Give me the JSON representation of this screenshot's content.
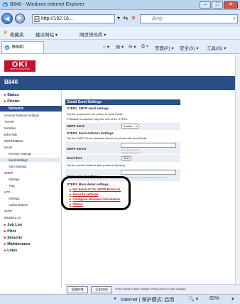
{
  "window": {
    "title": "B840 - Windows Internet Explorer",
    "minimize": "‒",
    "maximize": "□",
    "close": "✕"
  },
  "nav": {
    "back": "◀",
    "forward": "▶",
    "address": "http://192.16...",
    "address_dropdown": "▾",
    "refresh": "⟳",
    "compat": "⇆",
    "stop": "✕",
    "search_placeholder": "Bing",
    "search_icon": "⌕"
  },
  "favorites_bar": {
    "favorites": "收藏夹",
    "suggested": "建议网站 ▾",
    "gallery": "网页快讯库 ▾"
  },
  "tab": {
    "label": "B840"
  },
  "command_bar": {
    "home": "⌂ ▾",
    "feeds": "▤ ▾",
    "mail": "✉ ▾",
    "print": "⎙ ▾",
    "page": "页面(P) ▾",
    "safety": "安全(S) ▾",
    "tools": "工具(O) ▾"
  },
  "brand": {
    "logo": "OKI",
    "tagline": "PRINTING SOLUTIONS",
    "model": "B840"
  },
  "sidebar": {
    "status": "Status",
    "printer": "Printer",
    "network": "Network",
    "items": [
      "General Network Settings",
      "TCP/IP",
      "NetWare",
      "EtherTalk",
      "NBT/NetBEUI",
      "Email",
      "Receive Settings",
      "Send Settings",
      "Alert Settings",
      "SNMP",
      "Settings",
      "Trap",
      "LPP",
      "Settings",
      "Authentication",
      "SNTP",
      "IEEE802.1X"
    ],
    "job_list": "Job List",
    "print": "Print",
    "security": "Security",
    "maintenance": "Maintenance",
    "links": "Links"
  },
  "main": {
    "title": "Email Send Settings",
    "step1": "STEP1. SMTP send settings",
    "step1_desc1": "Set the protocol for the printer to send Email.",
    "step1_desc2": "If Disable is selected, skip the rest of the STEPs.",
    "smtp_send_label": "SMTP Send",
    "smtp_send_value": "Enable",
    "step2": "STEP2. Send Address Settings",
    "step2_desc": "Set the SMTP Server Address where the printer will send Email.",
    "smtp_server_label": "SMTP Server",
    "smtp_server_hint1": "Enter Email Server.",
    "smtp_server_hint2": "(Max.64 characters)",
    "send_test_label": "Send Test",
    "send_test_button": "Test",
    "sender_desc": "Set the sender Address (this printer's Address).",
    "printer_email_label": "Printer Email Address",
    "printer_email_hint": "(Max.80 characters)  Unable Email transmissions",
    "step3": "STEP3. More detail settings",
    "links": [
      "Set detail of the SMTP Protocol.",
      "Security settings",
      "Configure attached information",
      "Others"
    ]
  },
  "footer": {
    "submit": "Submit",
    "cancel": "Cancel",
    "note": "Press Submit to send changes. Press Cancel to clear changes."
  },
  "status_bar": {
    "zone": "Internet | 保护模式: 启用",
    "zoom_icon": "🔍 ▾",
    "zoom": "65%",
    "zoom_dropdown": "▾"
  }
}
